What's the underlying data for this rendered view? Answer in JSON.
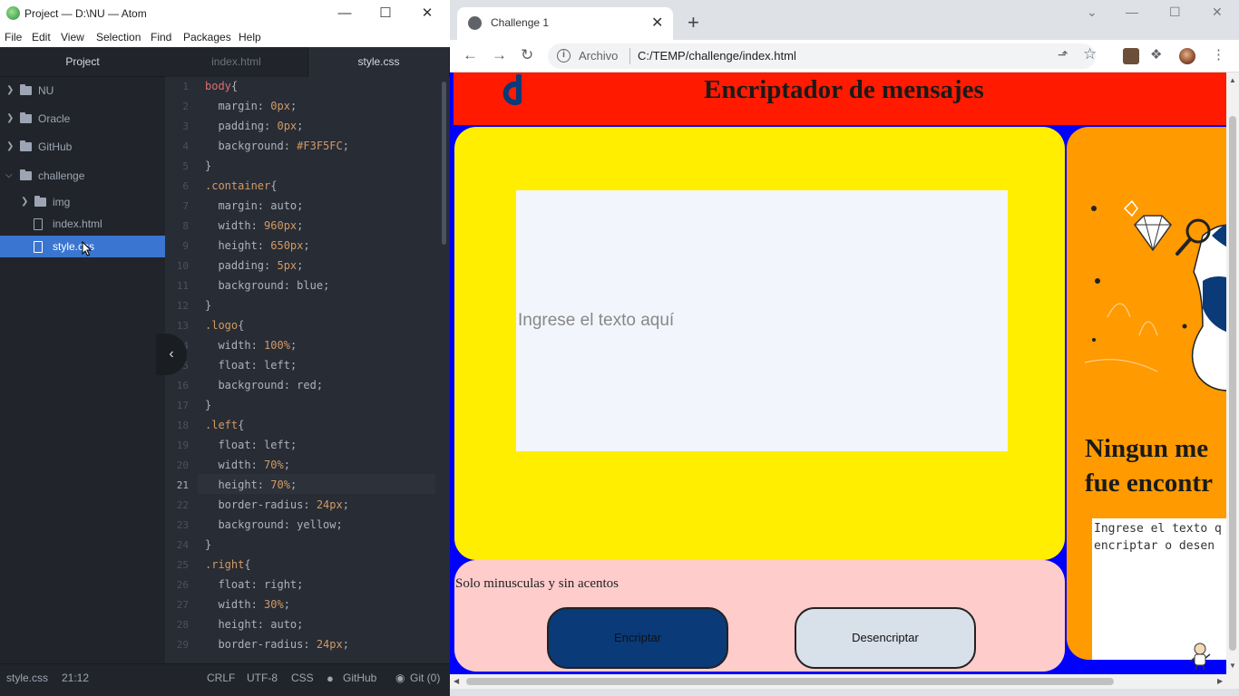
{
  "atom": {
    "title": "Project — D:\\NU — Atom",
    "window_controls": [
      "—",
      "☐",
      "✕"
    ],
    "menu": [
      "File",
      "Edit",
      "View",
      "Selection",
      "Find",
      "Packages",
      "Help"
    ],
    "tree_header": "Project",
    "tree": [
      {
        "label": "NU",
        "type": "folder",
        "expanded": false
      },
      {
        "label": "Oracle",
        "type": "folder",
        "expanded": false
      },
      {
        "label": "GitHub",
        "type": "folder",
        "expanded": false
      },
      {
        "label": "challenge",
        "type": "folder",
        "expanded": true
      },
      {
        "label": "img",
        "type": "folder",
        "expanded": false
      },
      {
        "label": "index.html",
        "type": "file"
      },
      {
        "label": "style.css",
        "type": "file",
        "selected": true
      }
    ],
    "tabs": [
      {
        "label": "index.html",
        "active": false
      },
      {
        "label": "style.css",
        "active": true
      }
    ],
    "code": [
      [
        "body{",
        "sel"
      ],
      [
        "  margin: 0px;",
        "decl"
      ],
      [
        "  padding: 0px;",
        "decl"
      ],
      [
        "  background: #F3F5FC;",
        "decl"
      ],
      [
        "}",
        "close"
      ],
      [
        ".container{",
        "sel"
      ],
      [
        "  margin: auto;",
        "decl"
      ],
      [
        "  width: 960px;",
        "decl"
      ],
      [
        "  height: 650px;",
        "decl"
      ],
      [
        "  padding: 5px;",
        "decl"
      ],
      [
        "  background: blue;",
        "decl"
      ],
      [
        "}",
        "close"
      ],
      [
        ".logo{",
        "sel"
      ],
      [
        "  width: 100%;",
        "decl"
      ],
      [
        "  float: left;",
        "decl"
      ],
      [
        "  background: red;",
        "decl"
      ],
      [
        "}",
        "close"
      ],
      [
        ".left{",
        "sel"
      ],
      [
        "  float: left;",
        "decl"
      ],
      [
        "  width: 70%;",
        "decl"
      ],
      [
        "  height: 70%;",
        "decl"
      ],
      [
        "  border-radius: 24px;",
        "decl"
      ],
      [
        "  background: yellow;",
        "decl"
      ],
      [
        "}",
        "close"
      ],
      [
        ".right{",
        "sel"
      ],
      [
        "  float: right;",
        "decl"
      ],
      [
        "  width: 30%;",
        "decl"
      ],
      [
        "  height: auto;",
        "decl"
      ],
      [
        "  border-radius: 24px;",
        "decl"
      ]
    ],
    "current_line": 21,
    "status": {
      "file": "style.css",
      "cursor": "21:12",
      "line_ending": "CRLF",
      "encoding": "UTF-8",
      "grammar": "CSS",
      "github": "GitHub",
      "git": "Git (0)"
    }
  },
  "chrome": {
    "tab_title": "Challenge 1",
    "tab_close": "✕",
    "new_tab": "+",
    "url_scheme_label": "Archivo",
    "url": "C:/TEMP/challenge/index.html",
    "window_controls": [
      "⌄",
      "—",
      "☐",
      "✕"
    ]
  },
  "page": {
    "title": "Encriptador de mensajes",
    "input_placeholder": "Ingrese el texto aquí",
    "hint": "Solo minusculas y sin acentos",
    "encrypt_label": "Encriptar",
    "decrypt_label": "Desencriptar",
    "no_message": "Ningun mensaje fue encontrado",
    "no_message_line1": "Ningun me",
    "no_message_line2": "fue encontr",
    "result_text_line1": "Ingrese el texto q",
    "result_text_line2": "encriptar o desen",
    "colors": {
      "logo_bar": "#ff1a00",
      "container": "#0000ff",
      "left_panel": "#ffee00",
      "right_panel": "#ff9a00",
      "bottom_panel": "#ffcccc",
      "encrypt_button": "#0a3a78",
      "decrypt_button": "#d8e0ea"
    }
  }
}
